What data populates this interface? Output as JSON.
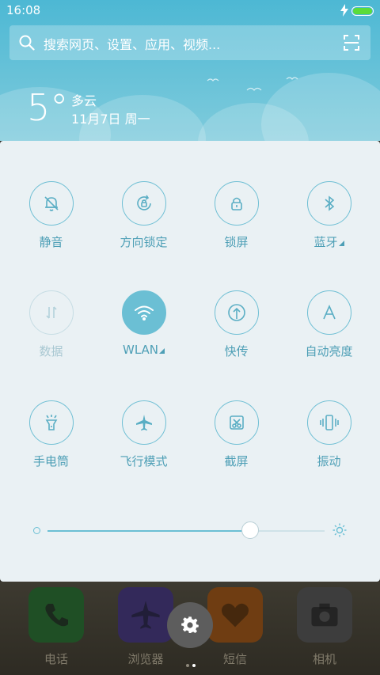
{
  "status": {
    "time": "16:08"
  },
  "search": {
    "placeholder": "搜索网页、设置、应用、视频..."
  },
  "weather": {
    "temp": "5°",
    "condition": "多云",
    "date": "11月7日 周一"
  },
  "toggles": [
    {
      "label": "静音",
      "state": "off",
      "icon": "bell-mute-icon"
    },
    {
      "label": "方向锁定",
      "state": "off",
      "icon": "rotation-lock-icon"
    },
    {
      "label": "锁屏",
      "state": "off",
      "icon": "lock-icon"
    },
    {
      "label": "蓝牙",
      "state": "off",
      "icon": "bluetooth-icon"
    },
    {
      "label": "数据",
      "state": "disabled",
      "icon": "mobile-data-icon"
    },
    {
      "label": "WLAN",
      "state": "on",
      "icon": "wifi-icon"
    },
    {
      "label": "快传",
      "state": "off",
      "icon": "quick-transfer-icon"
    },
    {
      "label": "自动亮度",
      "state": "off",
      "icon": "auto-brightness-icon"
    },
    {
      "label": "手电筒",
      "state": "off",
      "icon": "flashlight-icon"
    },
    {
      "label": "飞行模式",
      "state": "off",
      "icon": "airplane-icon"
    },
    {
      "label": "截屏",
      "state": "off",
      "icon": "screenshot-icon"
    },
    {
      "label": "振动",
      "state": "off",
      "icon": "vibrate-icon"
    }
  ],
  "brightness": {
    "level": 0.73
  },
  "dock": [
    {
      "label": "电话",
      "icon": "phone-icon",
      "color": "#1f5c2a"
    },
    {
      "label": "浏览器",
      "icon": "airplane-icon",
      "color": "#3d2f66"
    },
    {
      "label": "短信",
      "icon": "heart-icon",
      "color": "#8a4b10"
    },
    {
      "label": "相机",
      "icon": "camera-icon",
      "color": "#4a4a4a"
    }
  ],
  "colors": {
    "accent": "#6bbfd4",
    "header": "#4db8d4",
    "panel": "#eaf1f4"
  }
}
